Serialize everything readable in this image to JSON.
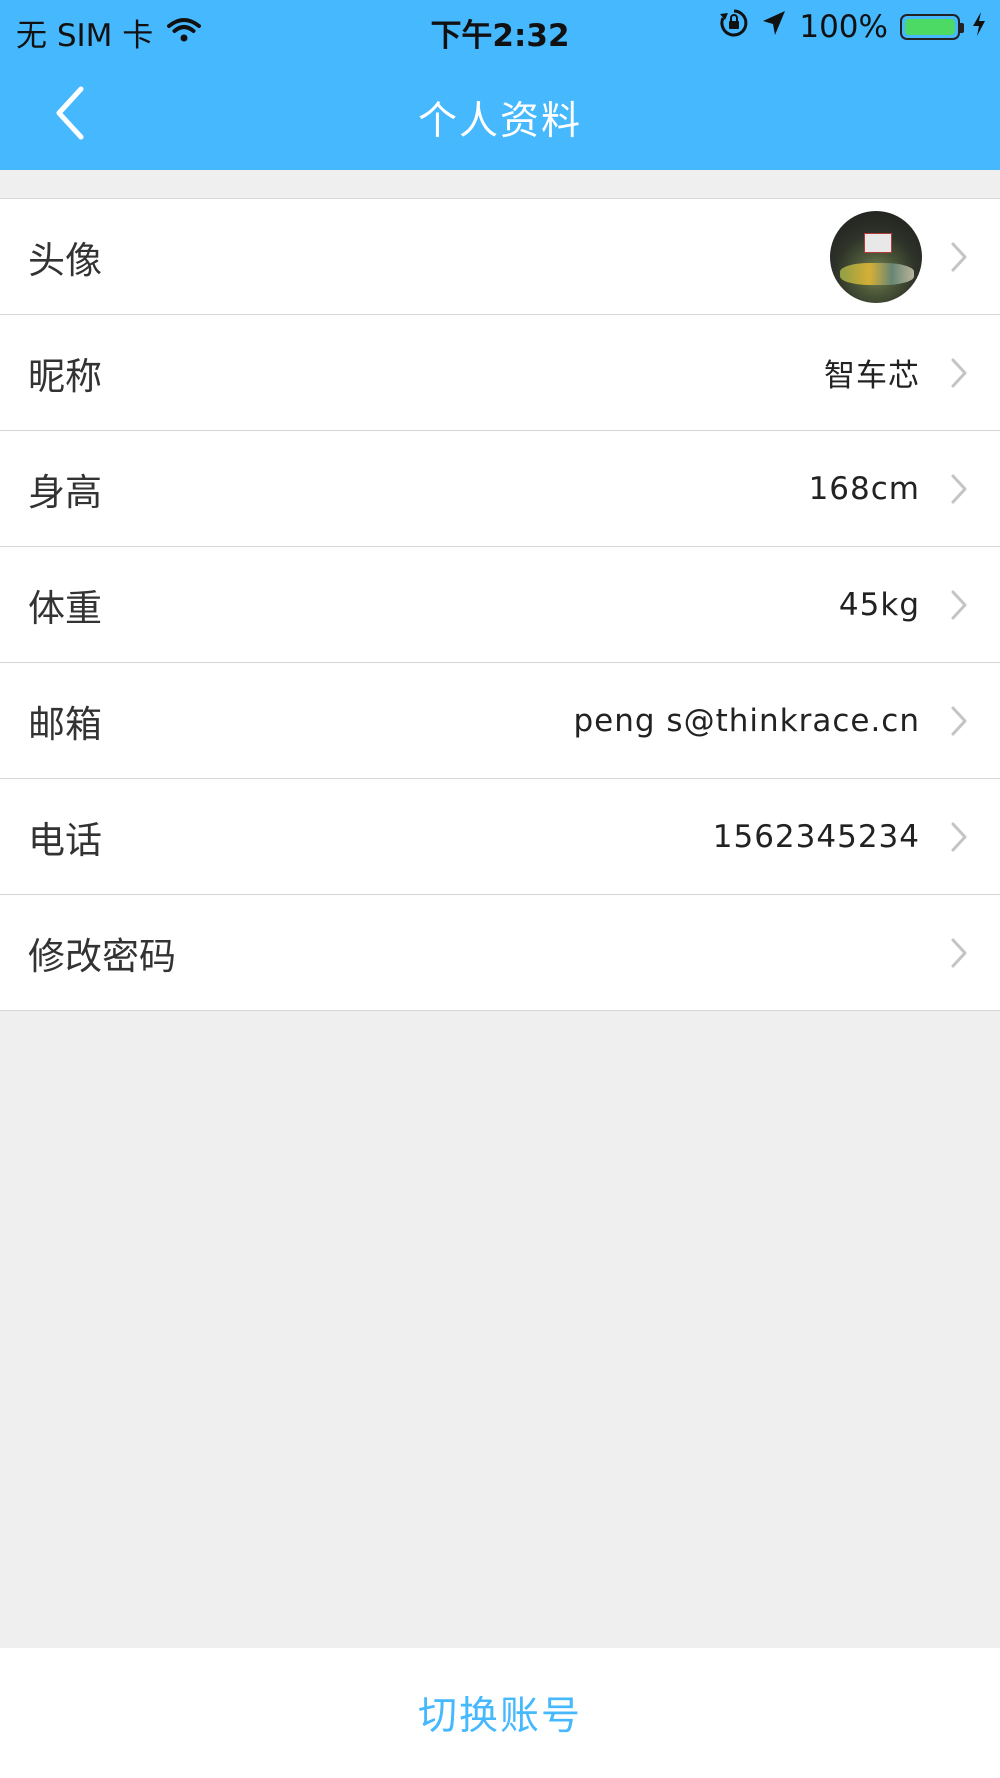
{
  "status_bar": {
    "carrier": "无 SIM 卡",
    "time": "下午2:32",
    "battery_percent": "100%",
    "battery_level": 1.0,
    "battery_color": "#4cd964"
  },
  "nav": {
    "title": "个人资料",
    "back_icon": "chevron-left-icon",
    "background_color": "#45b8fe"
  },
  "profile": {
    "rows": [
      {
        "label": "头像",
        "value": "",
        "has_avatar": true
      },
      {
        "label": "昵称",
        "value": "智车芯"
      },
      {
        "label": "身高",
        "value": "168cm"
      },
      {
        "label": "体重",
        "value": "45kg"
      },
      {
        "label": "邮箱",
        "value": "peng s@thinkrace.cn"
      },
      {
        "label": "电话",
        "value": "1562345234"
      },
      {
        "label": "修改密码",
        "value": ""
      }
    ]
  },
  "footer": {
    "switch_account": "切换账号",
    "accent_color": "#45b8fe"
  }
}
